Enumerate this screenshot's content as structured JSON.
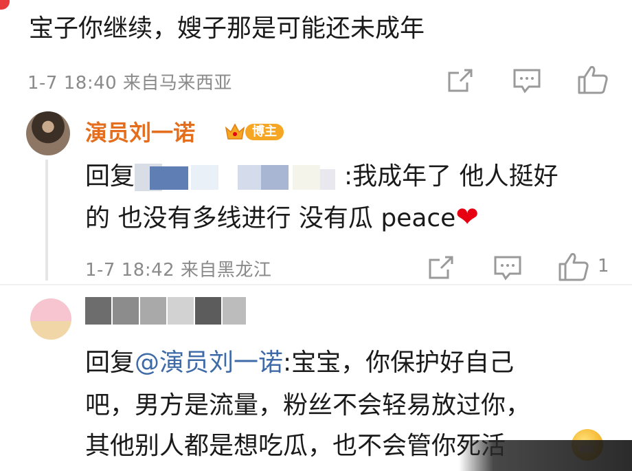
{
  "top_comment": {
    "text": "宝子你继续，嫂子那是可能还未成年",
    "meta": "1-7 18:40 来自马来西亚"
  },
  "reply1": {
    "username": "演员刘一诺",
    "badge": "博主",
    "line1_prefix": "回复",
    "line1_suffix": ":我成年了 他人挺好",
    "line2": "的 也没有多线进行 没有瓜 peace",
    "meta": "1-7 18:42 来自黑龙江",
    "like_count": "1"
  },
  "reply2": {
    "line1_prefix": "回复",
    "line1_mention": "@演员刘一诺",
    "line1_suffix": ":宝宝，你保护好自己",
    "line2": "吧，男方是流量，粉丝不会轻易放过你，",
    "line3": "其他别人都是想吃瓜，也不会管你死活"
  },
  "icons": {
    "share": "share-icon",
    "comment": "comment-icon",
    "like": "thumbs-up-icon",
    "heart": "heart-icon",
    "emoji": "face-emoji-icon",
    "crown": "crown-icon"
  },
  "colors": {
    "username": "#e46e1d",
    "badge": "#f5a623",
    "mention": "#3e6aa8",
    "meta": "#8a8a8a",
    "heart": "#e60012"
  }
}
